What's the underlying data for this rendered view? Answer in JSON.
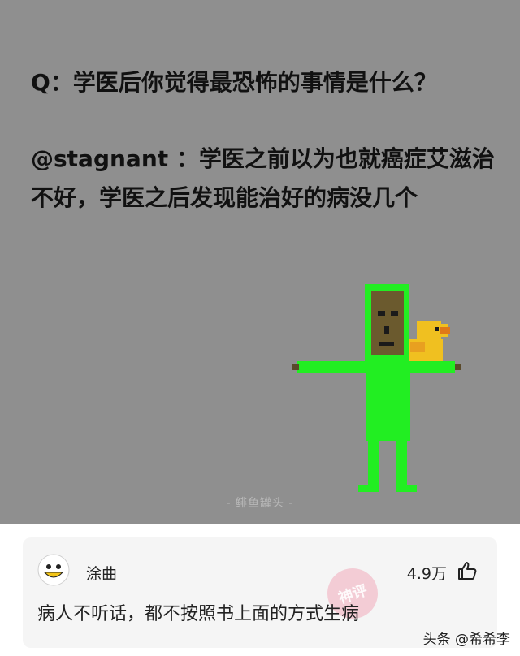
{
  "meme": {
    "question": "Q：学医后你觉得最恐怖的事情是什么？",
    "answer": "@stagnant ：学医之前以为也就癌症艾滋治不好，学医之后发现能治好的病没几个",
    "watermark": "- 鲱鱼罐头 -",
    "figure_icon": "pixel-man-with-duck",
    "colors": {
      "background": "#8f8f8f",
      "figure_body": "#22ee22",
      "duck": "#f0c020"
    }
  },
  "comment": {
    "avatar_icon": "smiling-face-avatar",
    "username": "涂曲",
    "likes": "4.9万",
    "thumb_icon": "thumbs-up-icon",
    "badge": "神评",
    "text": "病人不听话，都不按照书上面的方式生病"
  },
  "footer": {
    "source": "头条 @希希李"
  }
}
